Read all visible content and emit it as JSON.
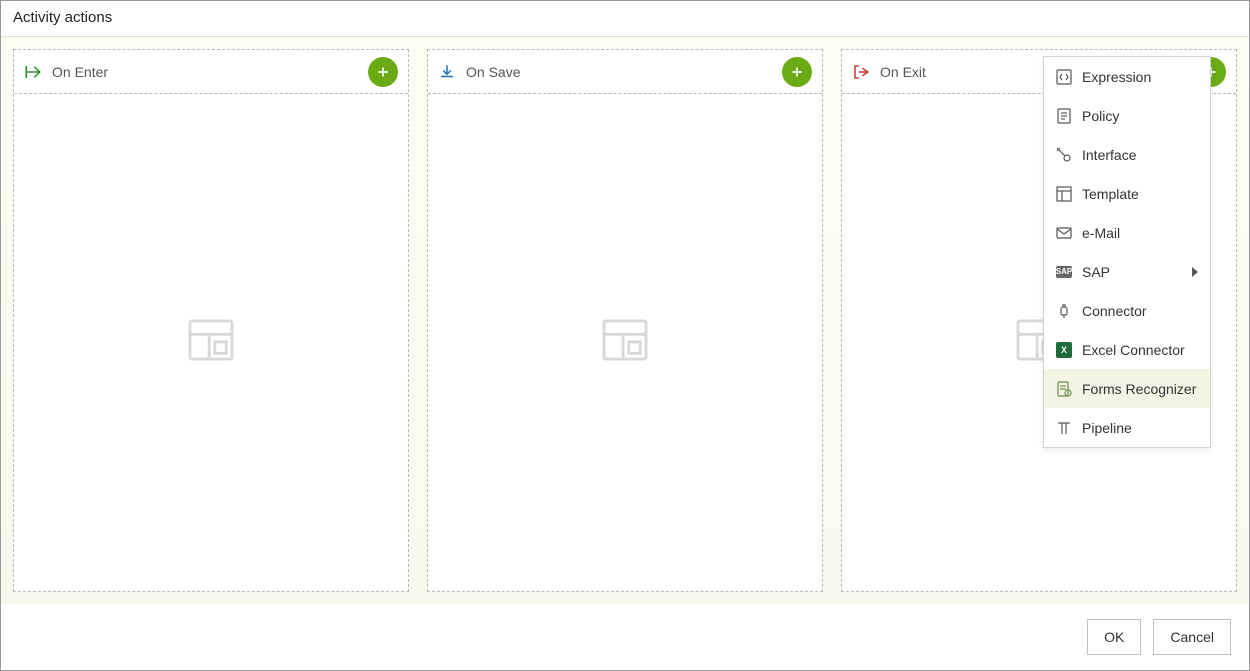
{
  "dialog": {
    "title": "Activity actions"
  },
  "columns": {
    "on_enter": {
      "label": "On Enter"
    },
    "on_save": {
      "label": "On Save"
    },
    "on_exit": {
      "label": "On Exit"
    }
  },
  "menu": {
    "expression": {
      "label": "Expression"
    },
    "policy": {
      "label": "Policy"
    },
    "interface": {
      "label": "Interface"
    },
    "template": {
      "label": "Template"
    },
    "email": {
      "label": "e-Mail"
    },
    "sap": {
      "label": "SAP"
    },
    "connector": {
      "label": "Connector"
    },
    "excel_connector": {
      "label": "Excel Connector"
    },
    "forms_recognizer": {
      "label": "Forms Recognizer"
    },
    "pipeline": {
      "label": "Pipeline"
    }
  },
  "footer": {
    "ok_label": "OK",
    "cancel_label": "Cancel"
  }
}
